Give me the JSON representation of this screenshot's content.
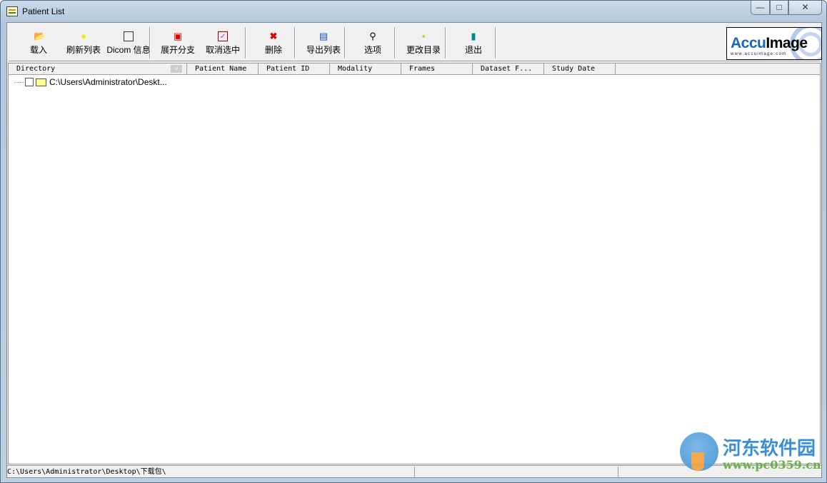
{
  "window": {
    "title": "Patient List",
    "controls": {
      "minimize": "—",
      "maximize": "□",
      "close": "✕"
    }
  },
  "toolbar": {
    "buttons": [
      {
        "label": "载入",
        "icon": "open-folder-icon"
      },
      {
        "label": "刷新列表",
        "icon": "lightbulb-icon"
      },
      {
        "label": "Dicom 信息",
        "icon": "info-sheet-icon"
      },
      {
        "label": "展开分支",
        "icon": "expand-tree-icon"
      },
      {
        "label": "取消选中",
        "icon": "checkbox-icon"
      },
      {
        "label": "删除",
        "icon": "delete-icon"
      },
      {
        "label": "导出列表",
        "icon": "export-icon"
      },
      {
        "label": "选项",
        "icon": "options-icon"
      },
      {
        "label": "更改目录",
        "icon": "tree-icon"
      },
      {
        "label": "退出",
        "icon": "exit-door-icon"
      }
    ]
  },
  "logo": {
    "name_blue": "Accu",
    "name_black": "Image",
    "url": "www.accuimage.com"
  },
  "list": {
    "columns": [
      "Directory",
      "Patient Name",
      "Patient ID",
      "Modality",
      "Frames",
      "Dataset F...",
      "Study Date"
    ],
    "rows": [
      {
        "directory": "C:\\Users\\Administrator\\Deskt..."
      }
    ]
  },
  "status": {
    "path": "C:\\Users\\Administrator\\Desktop\\下载包\\",
    "panel2": "",
    "panel3": ""
  },
  "watermark": {
    "name": "河东软件园",
    "url": "www.pc0359.cn"
  }
}
